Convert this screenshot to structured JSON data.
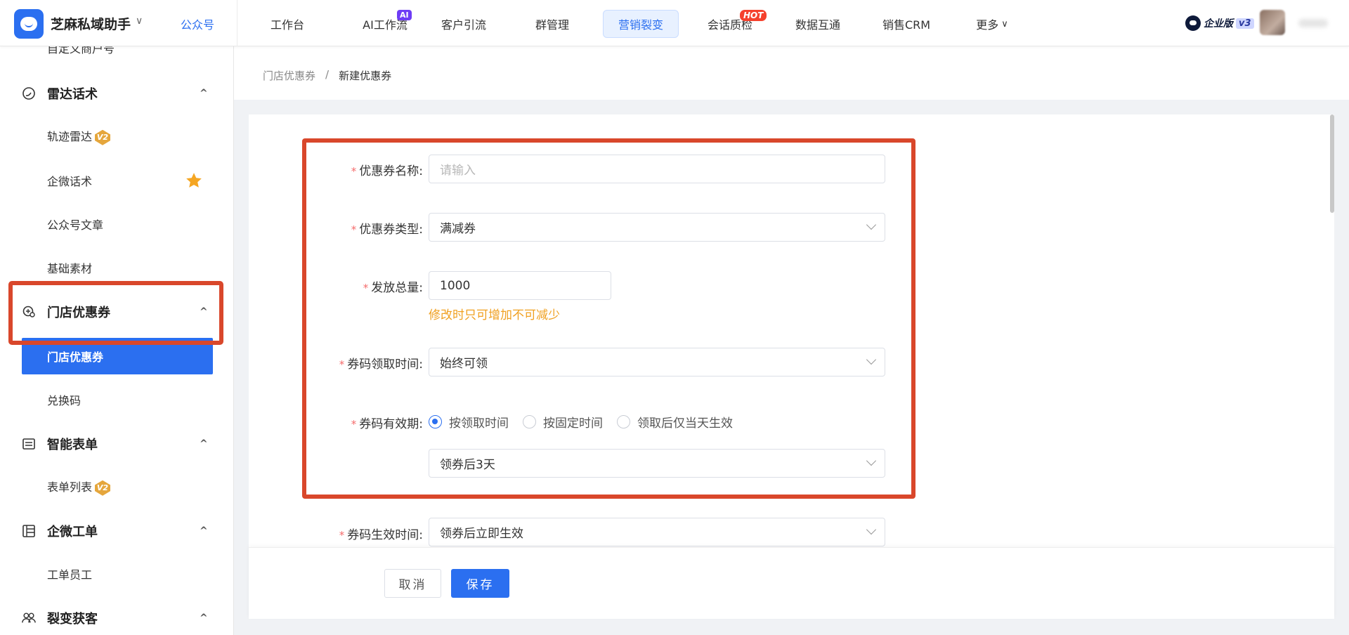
{
  "topbar": {
    "app_title": "芝麻私域助手",
    "app_switch": "公众号",
    "nav": [
      {
        "label": "工作台"
      },
      {
        "label": "AI工作流"
      },
      {
        "label": "客户引流"
      },
      {
        "label": "群管理"
      },
      {
        "label": "营销裂变",
        "active": true
      },
      {
        "label": "会话质检"
      },
      {
        "label": "数据互通"
      },
      {
        "label": "销售CRM"
      },
      {
        "label": "更多"
      }
    ],
    "ai_badge": "AI",
    "hot_badge": "HOT",
    "more_chevron": "∨",
    "enterprise_label": "企业版",
    "enterprise_version": "v3"
  },
  "sidebar": {
    "partial_top_item": "自定义商户号",
    "groups": [
      {
        "label": "雷达话术",
        "icon": "radar-icon"
      },
      {
        "label": "门店优惠券",
        "icon": "coupon-icon"
      },
      {
        "label": "智能表单",
        "icon": "form-icon"
      },
      {
        "label": "企微工单",
        "icon": "ticket-icon"
      },
      {
        "label": "裂变获客",
        "icon": "users-icon"
      }
    ],
    "items": {
      "track_radar": "轨迹雷达",
      "wecom_script": "企微话术",
      "mp_articles": "公众号文章",
      "basic_materials": "基础素材",
      "store_coupon": "门店优惠券",
      "redeem_code": "兑换码",
      "form_list": "表单列表",
      "ticket_staff": "工单员工"
    },
    "v2_badge": "V2",
    "group_chevron": "^"
  },
  "breadcrumb": {
    "parent": "门店优惠券",
    "separator": "/",
    "current": "新建优惠券"
  },
  "form": {
    "required_mark": "*",
    "coupon_name": {
      "label": "优惠券名称:",
      "value": "",
      "placeholder": "请输入"
    },
    "coupon_type": {
      "label": "优惠券类型:",
      "value": "满减券"
    },
    "total_issue": {
      "label": "发放总量:",
      "value": "1000",
      "hint": "修改时只可增加不可减少"
    },
    "claim_time": {
      "label": "券码领取时间:",
      "value": "始终可领"
    },
    "validity": {
      "label": "券码有效期:",
      "options": [
        "按领取时间",
        "按固定时间",
        "领取后仅当天生效"
      ],
      "selected_index": 0,
      "duration_value": "领券后3天"
    },
    "effective_time": {
      "label": "券码生效时间:",
      "value": "领券后立即生效"
    }
  },
  "footer": {
    "cancel_label": "取消",
    "save_label": "保存"
  },
  "colors": {
    "primary": "#2b6ff0",
    "highlight_border": "#d9472b",
    "hint": "#f0a020",
    "required": "#f56c6c"
  }
}
